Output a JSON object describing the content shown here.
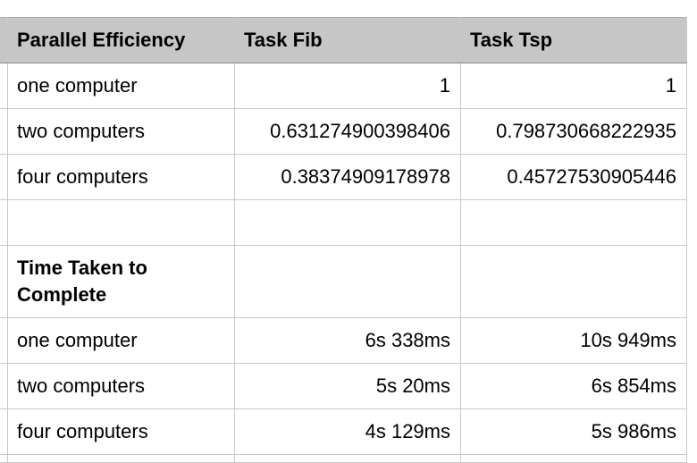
{
  "efficiency": {
    "headers": [
      "Parallel Efficiency",
      "Task Fib",
      "Task Tsp"
    ],
    "rows": [
      {
        "label": "one computer",
        "fib": "1",
        "tsp": "1"
      },
      {
        "label": "two computers",
        "fib": "0.631274900398406",
        "tsp": "0.798730668222935"
      },
      {
        "label": "four computers",
        "fib": "0.38374909178978",
        "tsp": "0.45727530905446"
      }
    ]
  },
  "time": {
    "title": "Time Taken to Complete",
    "rows": [
      {
        "label": "one computer",
        "fib": "6s 338ms",
        "tsp": "10s 949ms"
      },
      {
        "label": "two computers",
        "fib": "5s 20ms",
        "tsp": "6s 854ms"
      },
      {
        "label": "four computers",
        "fib": "4s 129ms",
        "tsp": "5s 986ms"
      }
    ]
  }
}
